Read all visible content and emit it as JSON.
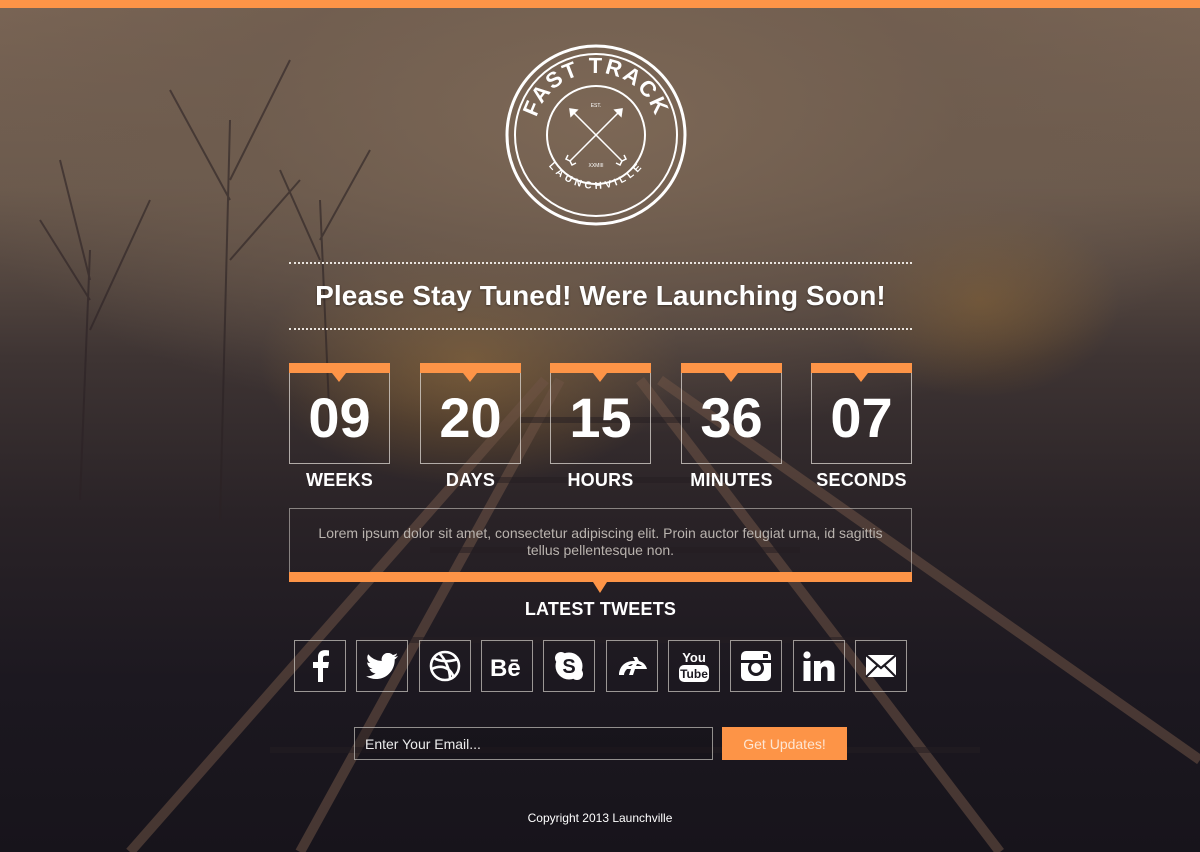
{
  "brand": {
    "logo_top_text": "FAST TRACK",
    "logo_bottom_text": "LAUNCHVILLE",
    "logo_est": "EST.",
    "logo_year": "XXMIII",
    "accent_color": "#fd9447"
  },
  "headline": "Please Stay Tuned! Were Launching Soon!",
  "countdown": [
    {
      "value": "09",
      "label": "WEEKS"
    },
    {
      "value": "20",
      "label": "DAYS"
    },
    {
      "value": "15",
      "label": "HOURS"
    },
    {
      "value": "36",
      "label": "MINUTES"
    },
    {
      "value": "07",
      "label": "SECONDS"
    }
  ],
  "about_text": "Lorem ipsum dolor sit amet, consectetur adipiscing elit. Proin auctor feugiat urna, id sagittis tellus pellentesque non.",
  "tweets_title": "LATEST TWEETS",
  "social": [
    {
      "name": "facebook",
      "icon": "facebook-icon"
    },
    {
      "name": "twitter",
      "icon": "twitter-icon"
    },
    {
      "name": "dribbble",
      "icon": "dribbble-icon"
    },
    {
      "name": "behance",
      "icon": "behance-icon"
    },
    {
      "name": "skype",
      "icon": "skype-icon"
    },
    {
      "name": "deviantart",
      "icon": "deviantart-icon"
    },
    {
      "name": "youtube",
      "icon": "youtube-icon"
    },
    {
      "name": "instagram",
      "icon": "instagram-icon"
    },
    {
      "name": "linkedin",
      "icon": "linkedin-icon"
    },
    {
      "name": "email",
      "icon": "mail-icon"
    }
  ],
  "subscribe": {
    "placeholder": "Enter Your Email...",
    "button_label": "Get Updates!"
  },
  "copyright": "Copyright 2013 Launchville"
}
